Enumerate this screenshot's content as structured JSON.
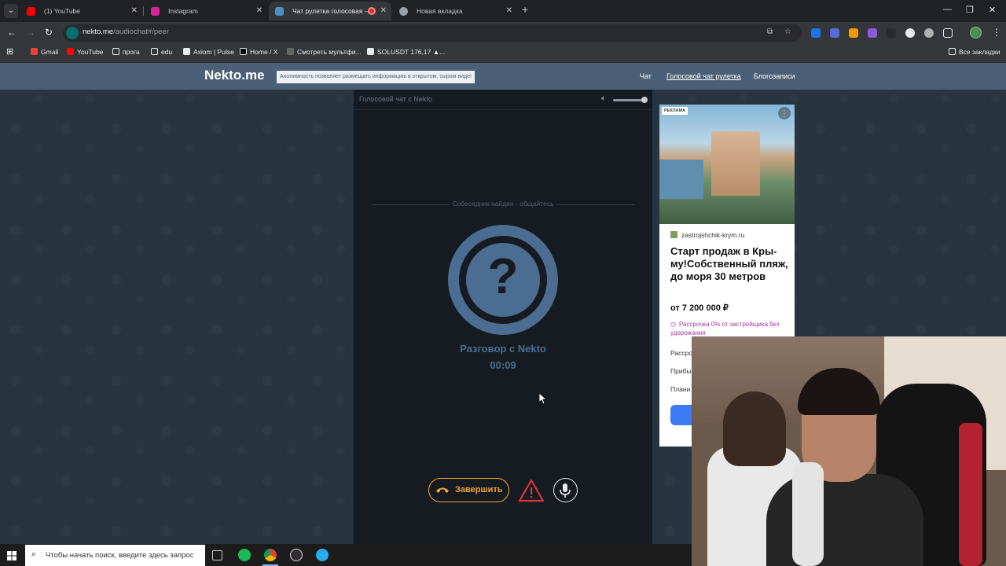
{
  "browser": {
    "tabs": [
      {
        "title": "(1) YouTube",
        "favicon": "youtube-icon",
        "color": "#ff0000",
        "active": false
      },
      {
        "title": "Instagram",
        "favicon": "instagram-icon",
        "color": "#d6249f",
        "active": false
      },
      {
        "title": "Чат рулетка голосовая — ",
        "favicon": "nekto-icon",
        "color": "#4a8fc0",
        "active": true
      },
      {
        "title": "Новая вкладка",
        "favicon": "chrome-icon",
        "color": "#9aa0a6",
        "active": false
      }
    ],
    "url_domain": "nekto.me",
    "url_path": "/audiochat#/peer",
    "bookmarks": [
      {
        "label": "Gmail",
        "icon": "gmail-icon"
      },
      {
        "label": "YouTube",
        "icon": "youtube-icon"
      },
      {
        "label": "прога",
        "icon": "folder-icon"
      },
      {
        "label": "edu",
        "icon": "folder-icon"
      },
      {
        "label": "Axiom | Pulse",
        "icon": "axiom-icon"
      },
      {
        "label": "Home / X",
        "icon": "x-icon"
      },
      {
        "label": "Смотреть мультфи...",
        "icon": "site-icon"
      },
      {
        "label": "SOLUSDT 176,17 ▲...",
        "icon": "tradingview-icon"
      }
    ],
    "all_bookmarks": "Все закладки"
  },
  "site": {
    "logo": "Nekto.me",
    "notice": "Анонимность позволяет размещать информацию в открытом, сыром виде!",
    "nav": [
      {
        "label": "Чат",
        "selected": false
      },
      {
        "label": "Голосовой чат рулетка",
        "selected": true
      },
      {
        "label": "Блогозаписи",
        "selected": false
      }
    ]
  },
  "chat": {
    "header": "Голосовой чат с Nekto",
    "volume": 0.9,
    "status": "Собеседник найден - общайтесь",
    "conversation_label": "Разговор с Nekto",
    "timer": "00:09",
    "end_button": "Завершить",
    "accent": "#4a6d91",
    "end_color": "#f0a530",
    "report_color": "#d9333f"
  },
  "ad": {
    "badge": "РЕКЛАМА",
    "domain": "zastrojshchik-krym.ru",
    "title": "Старт продаж в Кры-му!Собственный пляж, до моря 30 метров",
    "price": "от 7 200 000 ₽",
    "credit": "Рассрочка 0% от застройщика без удорожания",
    "rows": [
      "Рассро",
      "Прибы",
      "Плани"
    ]
  },
  "taskbar": {
    "search_placeholder": "Чтобы начать поиск, введите здесь запрос",
    "apps": [
      "task-view-icon",
      "spotify-icon",
      "chrome-icon",
      "obs-icon",
      "telegram-icon"
    ]
  }
}
